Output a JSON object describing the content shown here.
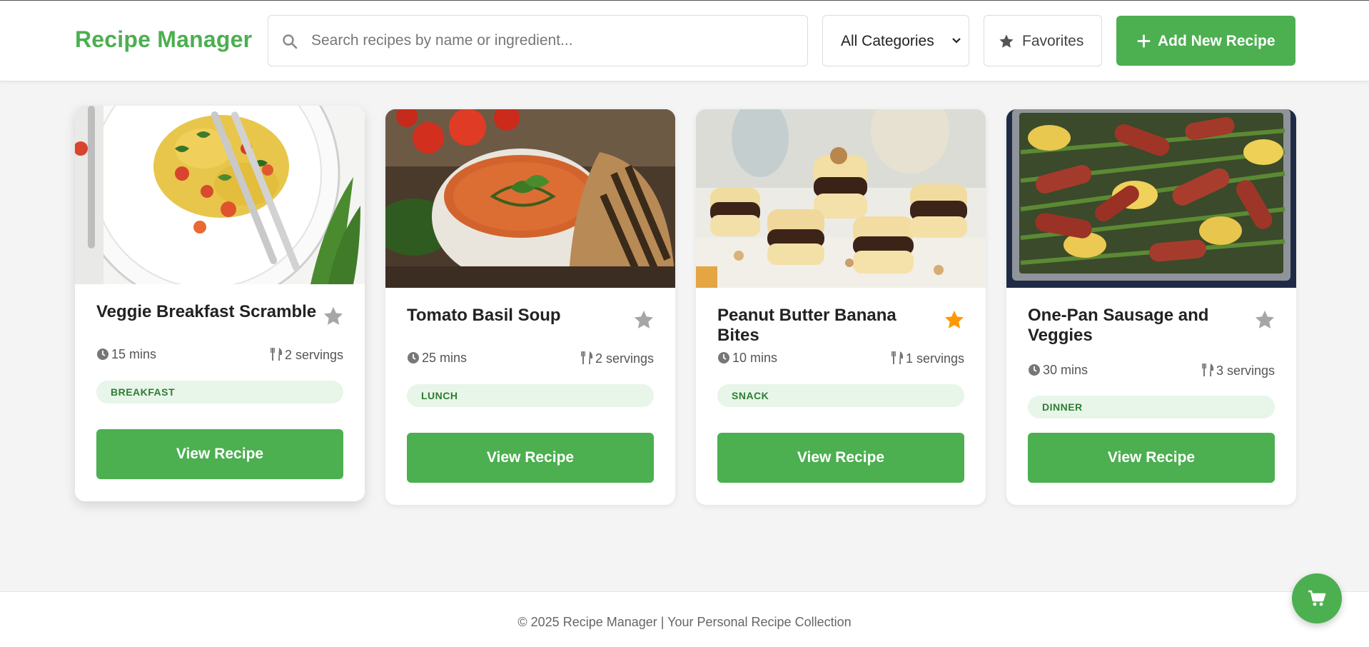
{
  "header": {
    "brand": "Recipe Manager",
    "search_placeholder": "Search recipes by name or ingredient...",
    "category_select": "All Categories",
    "favorites_label": "Favorites",
    "add_label": "Add New Recipe"
  },
  "colors": {
    "accent": "#4caf50",
    "tag_bg": "#e8f5e9",
    "tag_text": "#2e7d32",
    "star_inactive": "#9e9e9e",
    "star_active": "#ff9800"
  },
  "recipes": [
    {
      "title": "Veggie Breakfast Scramble",
      "time": "15 mins",
      "servings": "2 servings",
      "category": "BREAKFAST",
      "favorite": false,
      "button": "View Recipe"
    },
    {
      "title": "Tomato Basil Soup",
      "time": "25 mins",
      "servings": "2 servings",
      "category": "LUNCH",
      "favorite": false,
      "button": "View Recipe"
    },
    {
      "title": "Peanut Butter Banana Bites",
      "time": "10 mins",
      "servings": "1 servings",
      "category": "SNACK",
      "favorite": true,
      "button": "View Recipe"
    },
    {
      "title": "One-Pan Sausage and Veggies",
      "time": "30 mins",
      "servings": "3 servings",
      "category": "DINNER",
      "favorite": false,
      "button": "View Recipe"
    }
  ],
  "footer": {
    "text": "© 2025 Recipe Manager | Your Personal Recipe Collection"
  },
  "fab_icon": "shopping-cart-icon"
}
